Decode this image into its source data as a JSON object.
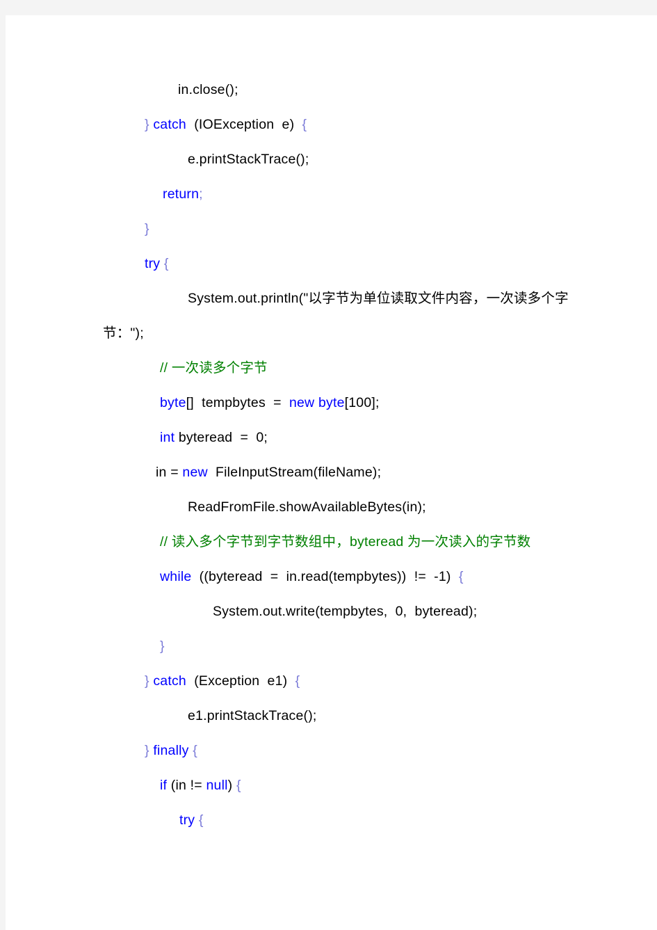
{
  "document": {
    "page_background": "#f4f4f4",
    "sheet_background": "#ffffff",
    "language": "Java",
    "colors": {
      "keyword": "#0000ff",
      "comment": "#008000",
      "plain": "#000000",
      "brace": "#7b7bd8"
    }
  },
  "code": {
    "lines": [
      {
        "id": "line-in-close",
        "indent": 108,
        "tokens": [
          {
            "t": "plain",
            "s": "in.close();"
          }
        ]
      },
      {
        "id": "line-catch-ioexception",
        "indent": 60,
        "tokens": [
          {
            "t": "brace",
            "s": "}"
          },
          {
            "t": "plain",
            "s": " "
          },
          {
            "t": "kw",
            "s": "catch"
          },
          {
            "t": "plain",
            "s": "  (IOException  e)  "
          },
          {
            "t": "brace",
            "s": "{"
          }
        ]
      },
      {
        "id": "line-e-printstacktrace",
        "indent": 122,
        "tokens": [
          {
            "t": "plain",
            "s": "e.printStackTrace();"
          }
        ]
      },
      {
        "id": "line-return",
        "indent": 86,
        "tokens": [
          {
            "t": "kw",
            "s": "return"
          },
          {
            "t": "brace",
            "s": ";"
          }
        ]
      },
      {
        "id": "line-close-brace-1",
        "indent": 60,
        "tokens": [
          {
            "t": "brace",
            "s": "}"
          }
        ]
      },
      {
        "id": "line-try-1",
        "indent": 60,
        "tokens": [
          {
            "t": "kw",
            "s": "try"
          },
          {
            "t": "plain",
            "s": " "
          },
          {
            "t": "brace",
            "s": "{"
          }
        ]
      },
      {
        "id": "line-println-chinese",
        "indent": 122,
        "tokens": [
          {
            "t": "plain",
            "s": "System.out.println(\"以字节为单位读取文件内容，一次读多个字节：\");"
          }
        ]
      },
      {
        "id": "line-comment-read-multi",
        "indent": 82,
        "tokens": [
          {
            "t": "comment",
            "s": "// 一次读多个字节"
          }
        ]
      },
      {
        "id": "line-tempbytes-decl",
        "indent": 82,
        "tokens": [
          {
            "t": "kw",
            "s": "byte"
          },
          {
            "t": "plain",
            "s": "[]  tempbytes  =  "
          },
          {
            "t": "kw",
            "s": "new byte"
          },
          {
            "t": "plain",
            "s": "[100];"
          }
        ]
      },
      {
        "id": "line-byteread-decl",
        "indent": 82,
        "tokens": [
          {
            "t": "kw",
            "s": "int"
          },
          {
            "t": "plain",
            "s": " byteread  =  0;"
          }
        ]
      },
      {
        "id": "line-in-new-fileinputstream",
        "indent": 76,
        "tokens": [
          {
            "t": "plain",
            "s": "in = "
          },
          {
            "t": "kw",
            "s": "new"
          },
          {
            "t": "plain",
            "s": "  FileInputStream(fileName);"
          }
        ]
      },
      {
        "id": "line-showavailablebytes",
        "indent": 122,
        "tokens": [
          {
            "t": "plain",
            "s": "ReadFromFile.showAvailableBytes(in);"
          }
        ]
      },
      {
        "id": "line-comment-byteread",
        "indent": 82,
        "tokens": [
          {
            "t": "comment",
            "s": "// 读入多个字节到字节数组中，byteread 为一次读入的字节数"
          }
        ]
      },
      {
        "id": "line-while-read",
        "indent": 82,
        "tokens": [
          {
            "t": "kw",
            "s": "while"
          },
          {
            "t": "plain",
            "s": "  ((byteread  =  in.read(tempbytes))  !=  -1)  "
          },
          {
            "t": "brace",
            "s": "{"
          }
        ]
      },
      {
        "id": "line-system-out-write",
        "indent": 158,
        "tokens": [
          {
            "t": "plain",
            "s": "System.out.write(tempbytes,  0,  byteread);"
          }
        ]
      },
      {
        "id": "line-close-brace-while",
        "indent": 82,
        "tokens": [
          {
            "t": "brace",
            "s": "}"
          }
        ]
      },
      {
        "id": "line-catch-exception-e1",
        "indent": 60,
        "tokens": [
          {
            "t": "brace",
            "s": "}"
          },
          {
            "t": "plain",
            "s": " "
          },
          {
            "t": "kw",
            "s": "catch"
          },
          {
            "t": "plain",
            "s": "  (Exception  e1)  "
          },
          {
            "t": "brace",
            "s": "{"
          }
        ]
      },
      {
        "id": "line-e1-printstacktrace",
        "indent": 122,
        "tokens": [
          {
            "t": "plain",
            "s": "e1.printStackTrace();"
          }
        ]
      },
      {
        "id": "line-finally",
        "indent": 60,
        "tokens": [
          {
            "t": "brace",
            "s": "}"
          },
          {
            "t": "plain",
            "s": " "
          },
          {
            "t": "kw",
            "s": "finally"
          },
          {
            "t": "plain",
            "s": " "
          },
          {
            "t": "brace",
            "s": "{"
          }
        ]
      },
      {
        "id": "line-if-in-not-null",
        "indent": 82,
        "tokens": [
          {
            "t": "kw",
            "s": "if"
          },
          {
            "t": "plain",
            "s": " (in != "
          },
          {
            "t": "kw",
            "s": "null"
          },
          {
            "t": "plain",
            "s": ") "
          },
          {
            "t": "brace",
            "s": "{"
          }
        ]
      },
      {
        "id": "line-try-2",
        "indent": 110,
        "tokens": [
          {
            "t": "kw",
            "s": "try"
          },
          {
            "t": "plain",
            "s": " "
          },
          {
            "t": "brace",
            "s": "{"
          }
        ]
      }
    ]
  }
}
